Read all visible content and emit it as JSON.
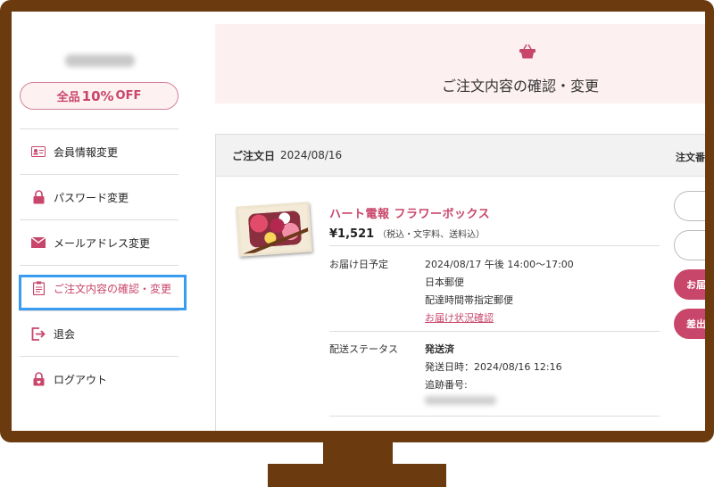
{
  "sidebar": {
    "discount": {
      "prefix": "全品",
      "value": "10%",
      "suffix": "OFF"
    },
    "items": [
      {
        "label": "会員情報変更",
        "icon": "id-card-icon"
      },
      {
        "label": "パスワード変更",
        "icon": "lock-icon"
      },
      {
        "label": "メールアドレス変更",
        "icon": "envelope-icon"
      },
      {
        "label": "ご注文内容の確認・変更",
        "icon": "clipboard-icon",
        "active": true
      },
      {
        "label": "退会",
        "icon": "exit-icon"
      },
      {
        "label": "ログアウト",
        "icon": "lock-heart-icon"
      }
    ]
  },
  "banner": {
    "icon": "basket-icon",
    "title": "ご注文内容の確認・変更"
  },
  "order": {
    "date_label": "ご注文日",
    "date": "2024/08/16",
    "number_label": "注文番",
    "product_name": "ハート電報 フラワーボックス",
    "price": "¥1,521",
    "price_note": "（税込・文字料、送料込）",
    "delivery_label": "お届け日予定",
    "delivery_date": "2024/08/17 午後 14:00～17:00",
    "carrier": "日本郵便",
    "service": "配達時間帯指定郵便",
    "tracking_link": "お届け状況確認",
    "status_label": "配送ステータス",
    "status": "発送済",
    "shipped_at": "発送日時：2024/08/16 12:16",
    "tracking_no_label": "追跡番号:"
  },
  "buttons": {
    "filled_1": "お届",
    "filled_2": "差出"
  },
  "colors": {
    "accent": "#c9466b",
    "frame": "#6b3a0e",
    "highlight": "#3a9cf0",
    "banner_bg": "#fdf0f0"
  }
}
